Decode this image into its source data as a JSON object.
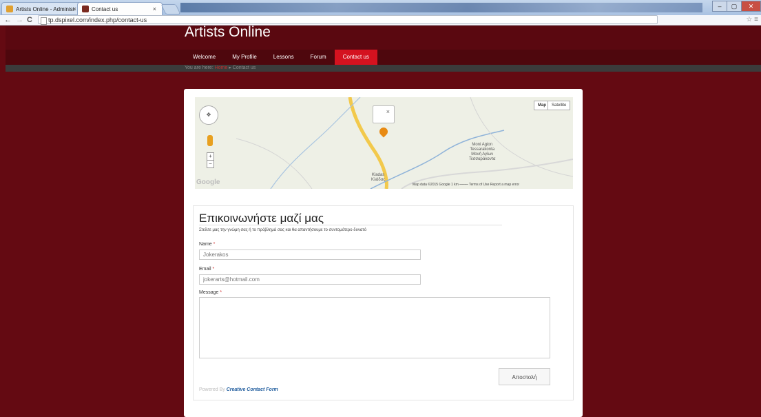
{
  "browser": {
    "tabs": [
      {
        "title": "Artists Online - Administ"
      },
      {
        "title": "Contact us"
      }
    ],
    "url": "tp.dspixel.com/index.php/contact-us",
    "nav_back": "←",
    "nav_forward": "→",
    "nav_reload": "C",
    "tab_close": "×"
  },
  "site": {
    "title": "Artists Online"
  },
  "menu": {
    "items": [
      {
        "label": "Welcome"
      },
      {
        "label": "My Profile"
      },
      {
        "label": "Lessons"
      },
      {
        "label": "Forum"
      },
      {
        "label": "Contact us"
      }
    ],
    "active": "Contact us"
  },
  "breadcrumb": {
    "prefix": "You are here:",
    "home": "Home",
    "separator": "▸",
    "current": "Contact us"
  },
  "map": {
    "type_map": "Map",
    "type_satellite": "Satellite",
    "zoom_in": "+",
    "zoom_out": "−",
    "infowindow_close": "×",
    "labels": {
      "moni": "Moni Agion\nTessarakonta\nΜονή Αγίων\nΤεσσαράκοντα",
      "kladas": "Kladas\nΚλάδας"
    },
    "logo": "Google",
    "footer": "Map data ©2015 Google   1 km ⎯⎯⎯⎯⎯   Terms of Use   Report a map error"
  },
  "form": {
    "title": "Επικοινωνήστε μαζί μας",
    "description": "Στείλτε μας την γνώμη σας ή το πρόβλημά σας και θα απαντήσουμε το συντομότερο δυνατό",
    "name_label": "Name",
    "name_value": "Jokerakos",
    "email_label": "Email",
    "email_value": "jokerarts@hotmail.com",
    "message_label": "Message",
    "message_value": "",
    "required_mark": "*",
    "submit_label": "Αποστολή",
    "powered_by": "Powered By",
    "powered_link": "Creative Contact Form"
  },
  "colors": {
    "page_bg": "#640a12",
    "menu_active": "#d4121f",
    "link": "#1c5a9c"
  }
}
